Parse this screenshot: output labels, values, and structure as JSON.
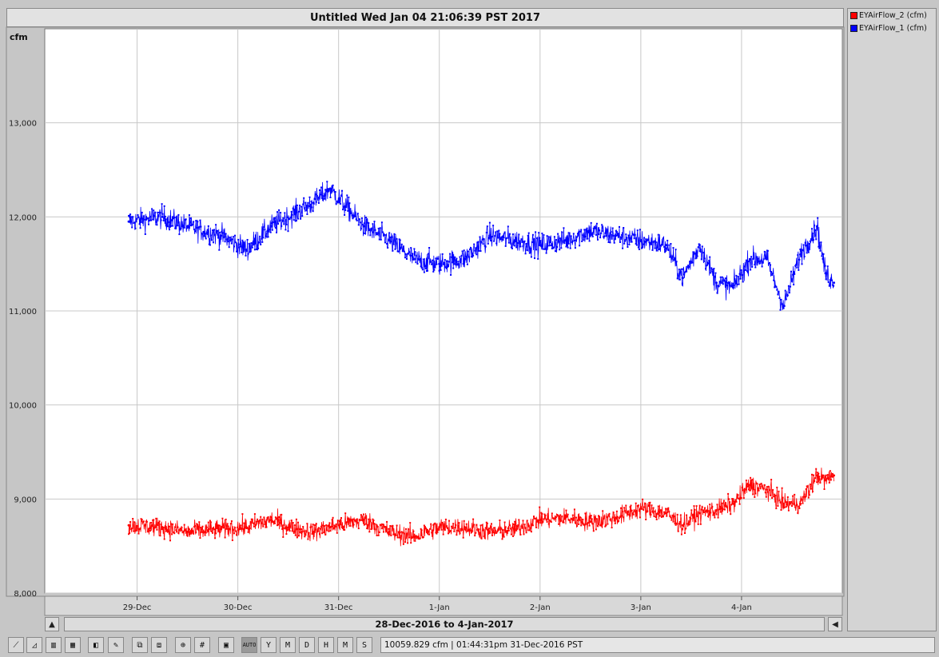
{
  "title": "Untitled Wed Jan 04 21:06:39 PST 2017",
  "unit_label": "cfm",
  "legend": [
    {
      "label": "EYAirFlow_2 (cfm)",
      "color": "#ff0000"
    },
    {
      "label": "EYAirFlow_1 (cfm)",
      "color": "#0000ff"
    }
  ],
  "range_label": "28-Dec-2016 to 4-Jan-2017",
  "status_text": "10059.829 cfm | 01:44:31pm 31-Dec-2016 PST",
  "toolbar": {
    "buttons": [
      {
        "name": "line-chart-icon",
        "glyph": "⟋"
      },
      {
        "name": "area-chart-icon",
        "glyph": "◿"
      },
      {
        "name": "bar-chart-icon",
        "glyph": "▥"
      },
      {
        "name": "column-chart-icon",
        "glyph": "▦"
      },
      {
        "name": "cube-icon",
        "glyph": "◧"
      },
      {
        "name": "brush-icon",
        "glyph": "✎"
      },
      {
        "name": "copy-icon",
        "glyph": "⧉"
      },
      {
        "name": "paste-icon",
        "glyph": "⧈"
      },
      {
        "name": "zoom-icon",
        "glyph": "⊕"
      },
      {
        "name": "grid-icon",
        "glyph": "#"
      },
      {
        "name": "save-icon",
        "glyph": "▣"
      },
      {
        "name": "auto-button",
        "glyph": "AUTO"
      },
      {
        "name": "year-button",
        "glyph": "Y"
      },
      {
        "name": "month-button",
        "glyph": "M"
      },
      {
        "name": "day-button",
        "glyph": "D"
      },
      {
        "name": "hour-button",
        "glyph": "H"
      },
      {
        "name": "minute-button",
        "glyph": "M"
      },
      {
        "name": "second-button",
        "glyph": "S"
      }
    ]
  },
  "chart_data": {
    "type": "line",
    "ylim": [
      8000,
      14000
    ],
    "yticks": [
      8000,
      9000,
      10000,
      11000,
      12000,
      13000
    ],
    "ytick_labels": [
      "8,000",
      "9,000",
      "10,000",
      "11,000",
      "12,000",
      "13,000"
    ],
    "xlim": [
      "2016-12-28T02:00",
      "2017-01-05T00:00"
    ],
    "xticks": [
      "2016-12-29",
      "2016-12-30",
      "2016-12-31",
      "2017-01-01",
      "2017-01-02",
      "2017-01-03",
      "2017-01-04"
    ],
    "xtick_labels": [
      "29-Dec",
      "30-Dec",
      "31-Dec",
      "1-Jan",
      "2-Jan",
      "3-Jan",
      "4-Jan"
    ],
    "grid": true,
    "legend_position": "right",
    "series": [
      {
        "name": "EYAirFlow_1 (cfm)",
        "color": "#0000ff",
        "noise": 130,
        "x": [
          "2016-12-28T22:00",
          "2016-12-29T06:00",
          "2016-12-29T12:00",
          "2016-12-29T20:00",
          "2016-12-30T02:00",
          "2016-12-30T08:00",
          "2016-12-30T14:00",
          "2016-12-30T18:00",
          "2016-12-30T22:00",
          "2016-12-31T06:00",
          "2016-12-31T12:00",
          "2016-12-31T18:00",
          "2017-01-01T00:00",
          "2017-01-01T06:00",
          "2017-01-01T12:00",
          "2017-01-01T18:00",
          "2017-01-02T00:00",
          "2017-01-02T06:00",
          "2017-01-02T12:00",
          "2017-01-02T18:00",
          "2017-01-03T00:00",
          "2017-01-03T06:00",
          "2017-01-03T10:00",
          "2017-01-03T14:00",
          "2017-01-03T18:00",
          "2017-01-03T22:00",
          "2017-01-04T02:00",
          "2017-01-04T06:00",
          "2017-01-04T10:00",
          "2017-01-04T14:00",
          "2017-01-04T18:00",
          "2017-01-04T20:00",
          "2017-01-04T22:00"
        ],
        "values": [
          11950,
          12000,
          11900,
          11800,
          11650,
          11900,
          12050,
          12150,
          12300,
          11900,
          11750,
          11550,
          11500,
          11550,
          11800,
          11750,
          11700,
          11750,
          11850,
          11800,
          11750,
          11700,
          11350,
          11700,
          11300,
          11250,
          11550,
          11550,
          11050,
          11600,
          11900,
          11400,
          11300
        ]
      },
      {
        "name": "EYAirFlow_2 (cfm)",
        "color": "#ff0000",
        "noise": 110,
        "x": [
          "2016-12-28T22:00",
          "2016-12-29T06:00",
          "2016-12-29T12:00",
          "2016-12-29T20:00",
          "2016-12-30T02:00",
          "2016-12-30T08:00",
          "2016-12-30T14:00",
          "2016-12-30T18:00",
          "2016-12-30T22:00",
          "2016-12-31T06:00",
          "2016-12-31T12:00",
          "2016-12-31T18:00",
          "2017-01-01T00:00",
          "2017-01-01T06:00",
          "2017-01-01T12:00",
          "2017-01-01T18:00",
          "2017-01-02T00:00",
          "2017-01-02T06:00",
          "2017-01-02T12:00",
          "2017-01-02T18:00",
          "2017-01-03T00:00",
          "2017-01-03T06:00",
          "2017-01-03T10:00",
          "2017-01-03T14:00",
          "2017-01-03T18:00",
          "2017-01-03T22:00",
          "2017-01-04T02:00",
          "2017-01-04T06:00",
          "2017-01-04T10:00",
          "2017-01-04T14:00",
          "2017-01-04T18:00",
          "2017-01-04T20:00",
          "2017-01-04T22:00"
        ],
        "values": [
          8720,
          8700,
          8650,
          8680,
          8700,
          8780,
          8680,
          8650,
          8700,
          8780,
          8650,
          8600,
          8700,
          8700,
          8650,
          8680,
          8780,
          8800,
          8760,
          8800,
          8900,
          8850,
          8720,
          8850,
          8880,
          8950,
          9150,
          9100,
          8950,
          8950,
          9250,
          9200,
          9250
        ]
      }
    ]
  }
}
